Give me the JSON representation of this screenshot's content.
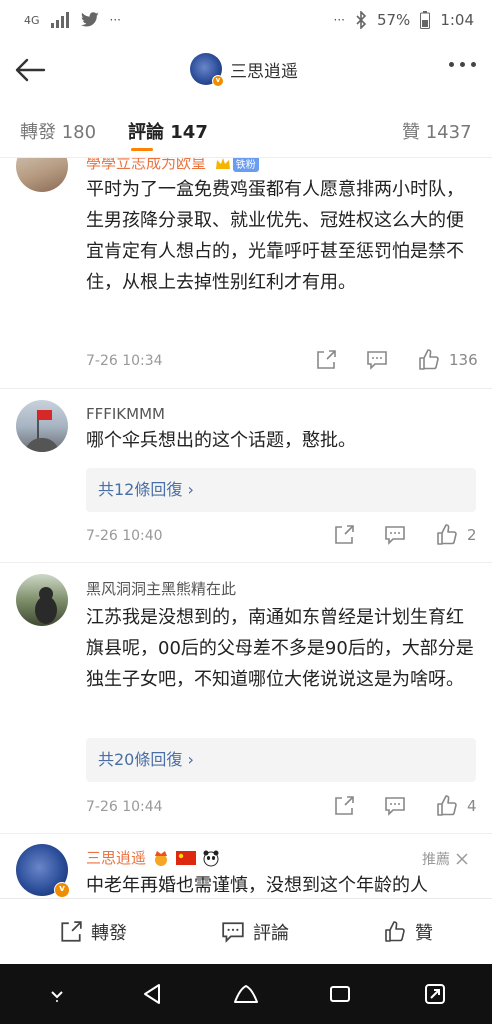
{
  "status_bar": {
    "network": "4G",
    "battery": "57%",
    "time": "1:04",
    "more": "···"
  },
  "header": {
    "title": "三思逍遥"
  },
  "tabs": [
    {
      "label": "轉發 180",
      "active": false
    },
    {
      "label": "評論 147",
      "active": true
    },
    {
      "label": "贊 1437",
      "active": false
    }
  ],
  "comments": [
    {
      "username": "學學立志成为欧皇",
      "badge": "铁粉",
      "text": "平时为了一盒免费鸡蛋都有人愿意排两小时队，生男孩降分录取、就业优先、冠姓权这么大的便宜肯定有人想占的，光靠呼吁甚至惩罚怕是禁不住，从根上去掉性别红利才有用。",
      "time": "7-26 10:34",
      "likes": "136"
    },
    {
      "username": "FFFIKMMM",
      "text": "哪个伞兵想出的这个话题，憨批。",
      "replies": "共12條回復 ›",
      "time": "7-26 10:40",
      "likes": "2"
    },
    {
      "username": "黑风洞洞主黑熊精在此",
      "text": "江苏我是没想到的，南通如东曾经是计划生育红旗县呢，00后的父母差不多是90后的，大部分是独生子女吧，不知道哪位大佬说说这是为啥呀。",
      "replies": "共20條回復 ›",
      "time": "7-26 10:44",
      "likes": "4"
    },
    {
      "username": "三思逍遥",
      "pin_label": "推薦",
      "text": "中老年再婚也需谨慎，没想到这个年龄的人"
    }
  ],
  "bottom_bar": {
    "repost": "轉發",
    "comment": "評論",
    "like": "贊"
  },
  "colors": {
    "accent": "#ff8200",
    "link": "#4a6fa5",
    "username_highlight": "#eb7340"
  }
}
